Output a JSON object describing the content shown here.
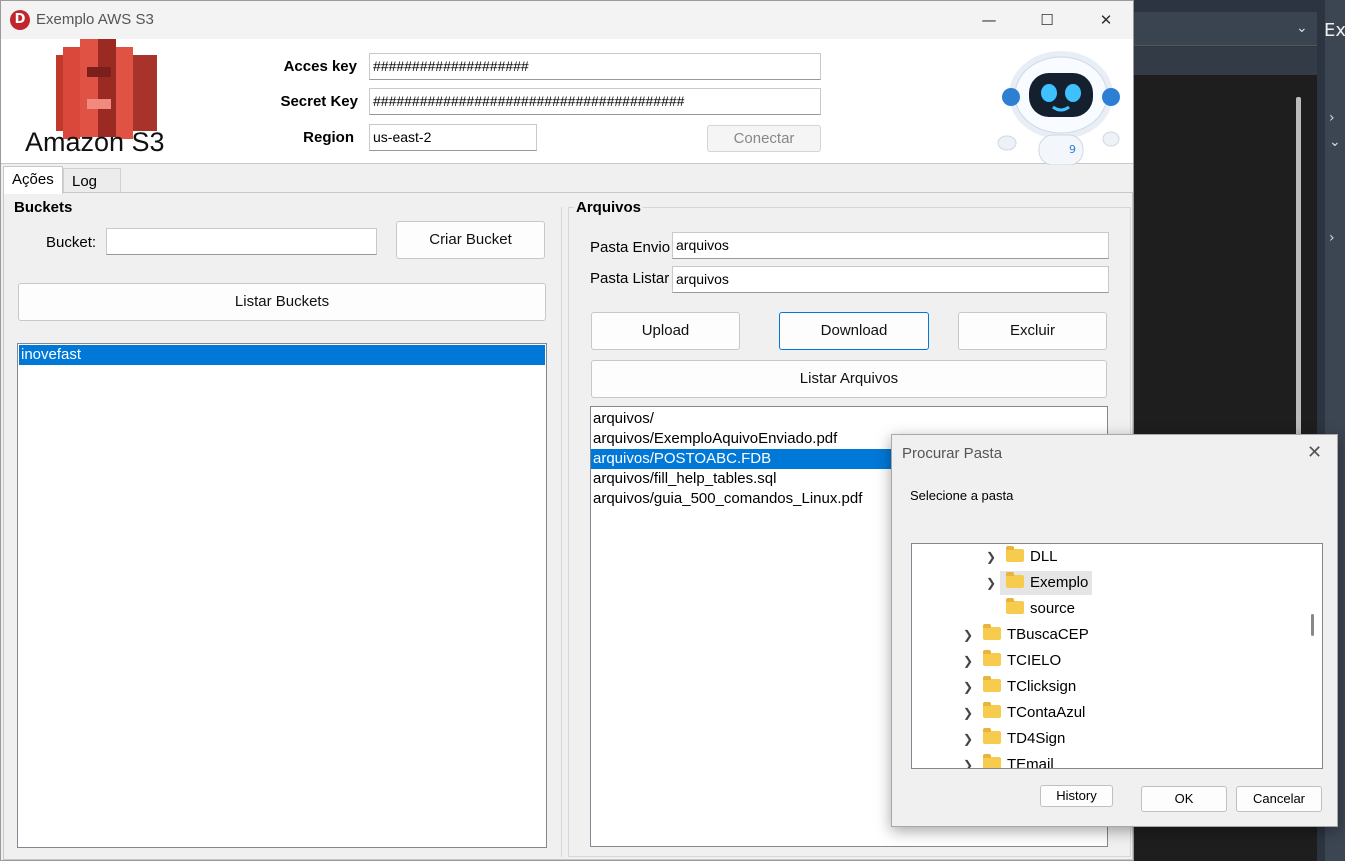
{
  "window": {
    "title": "Exemplo AWS S3",
    "app_icon_letter": "D",
    "controls": {
      "minimize": "—",
      "maximize": "☐",
      "close": "✕"
    }
  },
  "header": {
    "logo_text": "Amazon S3",
    "access_key_label": "Acces key",
    "access_key_value": "####################",
    "secret_key_label": "Secret Key",
    "secret_key_value": "########################################",
    "region_label": "Region",
    "region_value": "us-east-2",
    "connect_label": "Conectar"
  },
  "tabs": {
    "acoes": "Ações",
    "log": "Log"
  },
  "buckets": {
    "title": "Buckets",
    "bucket_label": "Bucket:",
    "bucket_value": "",
    "create_label": "Criar Bucket",
    "list_label": "Listar Buckets",
    "items": [
      "inovefast"
    ]
  },
  "arquivos": {
    "title": "Arquivos",
    "pasta_envio_label": "Pasta Envio",
    "pasta_envio_value": "arquivos",
    "pasta_listar_label": "Pasta Listar",
    "pasta_listar_value": "arquivos",
    "upload_label": "Upload",
    "download_label": "Download",
    "excluir_label": "Excluir",
    "listar_label": "Listar Arquivos",
    "files": [
      "arquivos/",
      "arquivos/ExemploAquivoEnviado.pdf",
      "arquivos/POSTOABC.FDB",
      "arquivos/fill_help_tables.sql",
      "arquivos/guia_500_comandos_Linux.pdf"
    ]
  },
  "dialog": {
    "title": "Procurar Pasta",
    "prompt": "Selecione a pasta",
    "tree": [
      {
        "label": "DLL",
        "expandable": true
      },
      {
        "label": "Exemplo",
        "expandable": true,
        "highlighted": true
      },
      {
        "label": "source",
        "expandable": false
      },
      {
        "label": "TBuscaCEP",
        "expandable": true
      },
      {
        "label": "TCIELO",
        "expandable": true
      },
      {
        "label": "TClicksign",
        "expandable": true
      },
      {
        "label": "TContaAzul",
        "expandable": true
      },
      {
        "label": "TD4Sign",
        "expandable": true
      },
      {
        "label": "TEmail",
        "expandable": true
      }
    ],
    "history_label": "History",
    "ok_label": "OK",
    "cancel_label": "Cancelar"
  },
  "background_ide": {
    "tab_fragment": "Ex"
  },
  "colors": {
    "selection": "#0078d7",
    "aws_red": "#e05243",
    "folder": "#f7cb4d"
  }
}
